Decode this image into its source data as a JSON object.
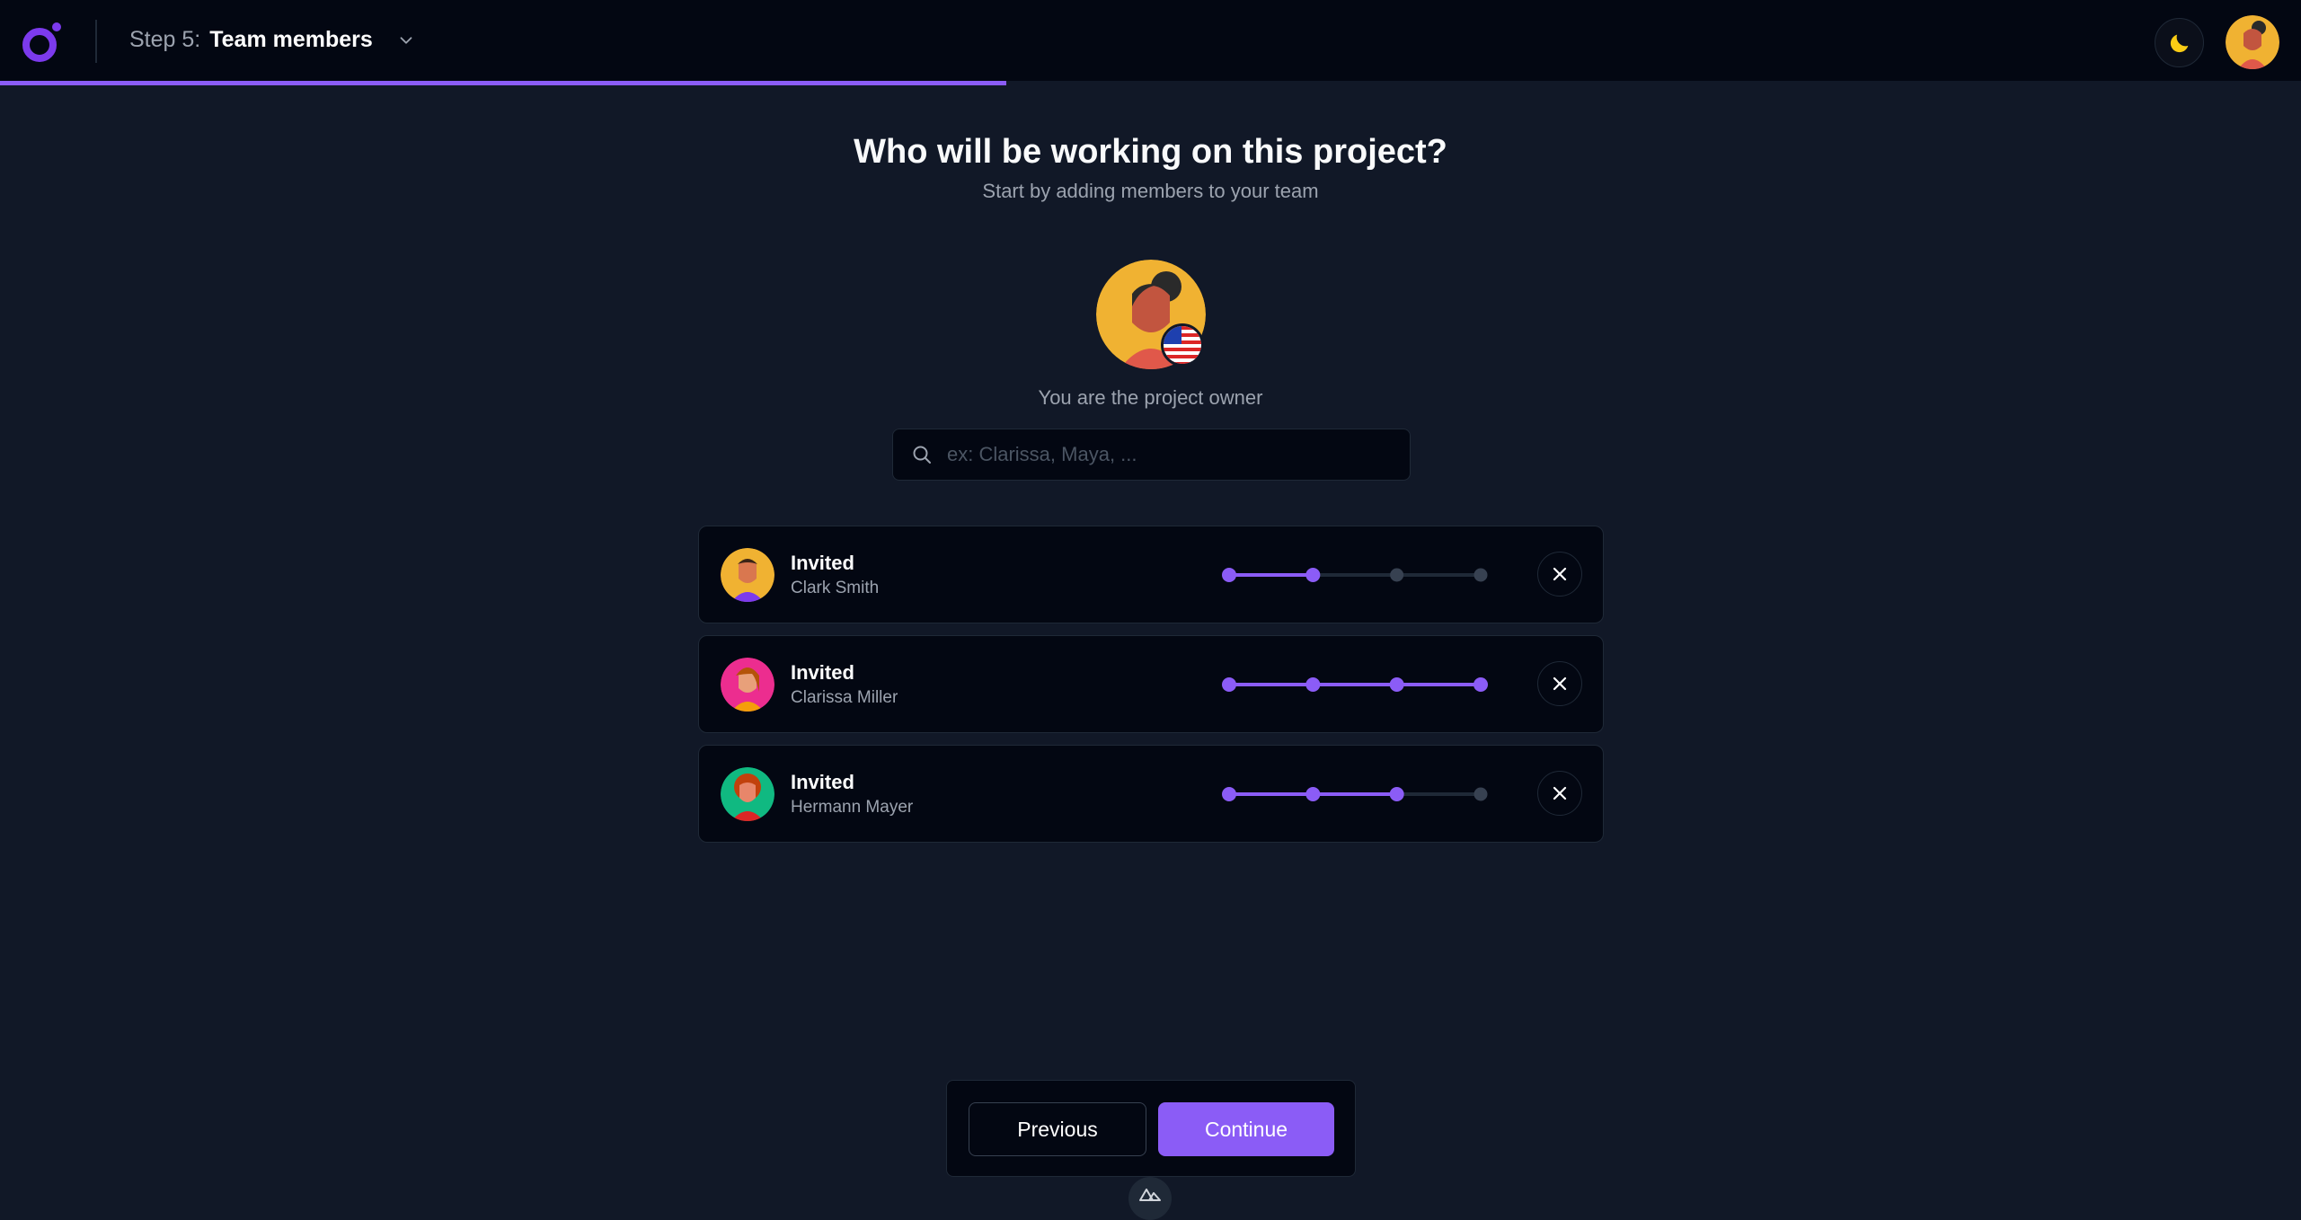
{
  "header": {
    "step_prefix": "Step 5:",
    "step_title": "Team members",
    "progress_fraction": 0.4375
  },
  "main": {
    "heading": "Who will be working on this project?",
    "subheading": "Start by adding members to your team",
    "owner_label": "You are the project owner",
    "search_placeholder": "ex: Clarissa, Maya, ..."
  },
  "members": [
    {
      "status": "Invited",
      "name": "Clark Smith",
      "level": 2,
      "levels_total": 4,
      "avatar_bg": "#f0b232"
    },
    {
      "status": "Invited",
      "name": "Clarissa Miller",
      "level": 4,
      "levels_total": 4,
      "avatar_bg": "#ec2d8f"
    },
    {
      "status": "Invited",
      "name": "Hermann Mayer",
      "level": 3,
      "levels_total": 4,
      "avatar_bg": "#10b981"
    }
  ],
  "footer": {
    "previous_label": "Previous",
    "continue_label": "Continue"
  },
  "colors": {
    "accent": "#8b5cf6",
    "background": "#111827",
    "surface": "#030712",
    "inactive": "#374151"
  }
}
